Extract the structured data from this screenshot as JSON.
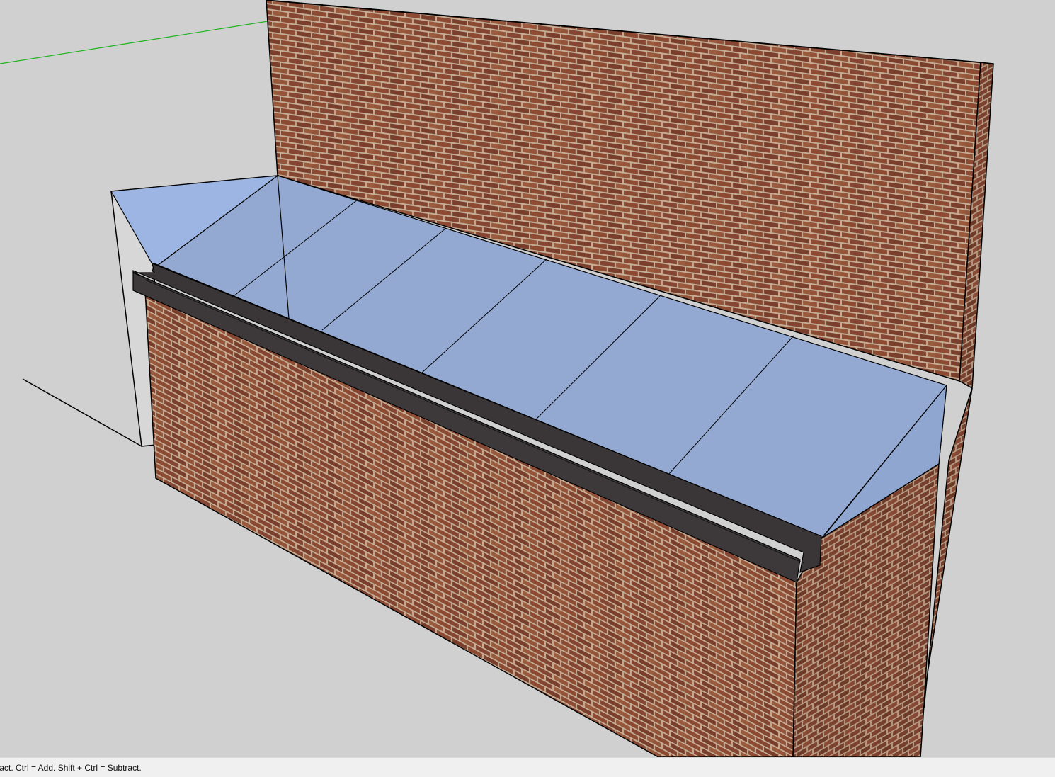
{
  "statusbar": {
    "hint": "tract. Ctrl = Add. Shift + Ctrl = Subtract."
  },
  "colors": {
    "viewport_background": "#d0d0d0",
    "brick_base": "#8a4a32",
    "brick_mortar": "#c9b49a",
    "glass": "#93a9d2",
    "glass_light": "#9db5e2",
    "gutter": "#3a3638",
    "axis_green": "#1db31d",
    "edge": "#000000"
  },
  "icons": {
    "model_scene": "3d-model-brick-wall-glass-canopy"
  }
}
